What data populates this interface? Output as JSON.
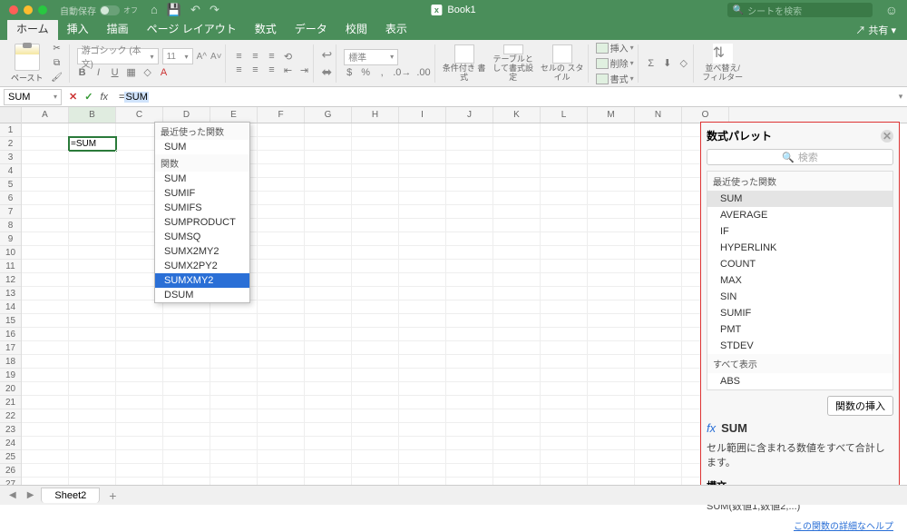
{
  "titlebar": {
    "autosave_label": "自動保存",
    "autosave_state": "オフ",
    "doc_title": "Book1",
    "search_placeholder": "シートを検索"
  },
  "menus": {
    "items": [
      "ホーム",
      "挿入",
      "描画",
      "ページ レイアウト",
      "数式",
      "データ",
      "校閲",
      "表示"
    ],
    "active": 0,
    "share": "共有"
  },
  "ribbon": {
    "paste_label": "ペースト",
    "font_name": "游ゴシック (本文)",
    "font_size": "11",
    "number_format": "標準",
    "cond_fmt": "条件付き\n書式",
    "table_fmt": "テーブルと\nして書式設定",
    "cell_style": "セルの\nスタイル",
    "insert": "挿入",
    "delete": "削除",
    "format": "書式",
    "sort_filter": "並べ替え/\nフィルター"
  },
  "formula_bar": {
    "name_box": "SUM",
    "input_prefix": "=",
    "input_highlight": "SUM"
  },
  "grid": {
    "columns": [
      "A",
      "B",
      "C",
      "D",
      "E",
      "F",
      "G",
      "H",
      "I",
      "J",
      "K",
      "L",
      "M",
      "N",
      "O"
    ],
    "rows": 27,
    "active_cell": {
      "row": 2,
      "col": "B",
      "display": "=SUM"
    }
  },
  "autocomplete": {
    "sections": [
      {
        "heading": "最近使った関数",
        "items": [
          "SUM"
        ]
      },
      {
        "heading": "関数",
        "items": [
          "SUM",
          "SUMIF",
          "SUMIFS",
          "SUMPRODUCT",
          "SUMSQ",
          "SUMX2MY2",
          "SUMX2PY2",
          "SUMXMY2",
          "DSUM"
        ]
      }
    ],
    "selected": "SUMXMY2"
  },
  "palette": {
    "title": "数式パレット",
    "search_placeholder": "検索",
    "sections": [
      {
        "heading": "最近使った関数",
        "items": [
          "SUM",
          "AVERAGE",
          "IF",
          "HYPERLINK",
          "COUNT",
          "MAX",
          "SIN",
          "SUMIF",
          "PMT",
          "STDEV"
        ]
      },
      {
        "heading": "すべて表示",
        "items": [
          "ABS"
        ]
      }
    ],
    "selected": "SUM",
    "insert_btn": "関数の挿入",
    "fn_name": "SUM",
    "fn_desc": "セル範囲に含まれる数値をすべて合計します。",
    "syntax_heading": "構文",
    "syntax": "SUM(数値1,数値2,...)",
    "help_link": "この関数の詳細なヘルプ"
  },
  "sheets": {
    "active": "Sheet2"
  }
}
